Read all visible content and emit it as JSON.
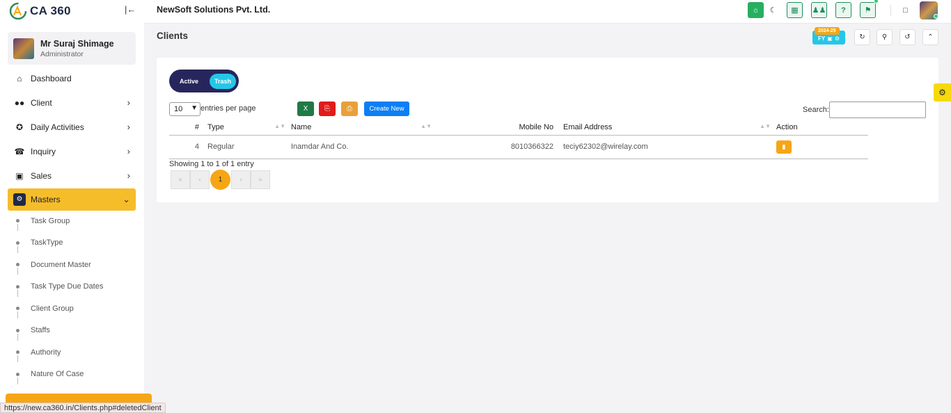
{
  "app": {
    "logo_text": "CA 360",
    "collapse_icon": "collapse-left-icon"
  },
  "user": {
    "name": "Mr Suraj Shimage",
    "role": "Administrator"
  },
  "sidebar": {
    "items": [
      {
        "label": "Dashboard",
        "icon": "home-icon"
      },
      {
        "label": "Client",
        "icon": "users-icon"
      },
      {
        "label": "Daily Activities",
        "icon": "pin-icon"
      },
      {
        "label": "Inquiry",
        "icon": "phone-icon"
      },
      {
        "label": "Sales",
        "icon": "money-icon"
      },
      {
        "label": "Masters",
        "icon": "gears-icon"
      }
    ],
    "sub_items": [
      "Task Group",
      "TaskType",
      "Document Master",
      "Task Type Due Dates",
      "Client Group",
      "Staffs",
      "Authority",
      "Nature Of Case"
    ]
  },
  "header": {
    "company": "NewSoft Solutions Pvt. Ltd."
  },
  "page": {
    "title": "Clients",
    "fy_year": "2024-25",
    "fy_label": "FY"
  },
  "toggle": {
    "active_label": "Active",
    "trash_label": "Trash"
  },
  "table_controls": {
    "page_length": "10",
    "length_label": "entries per page",
    "create_label": "Create New",
    "search_label": "Search:",
    "search_value": ""
  },
  "table": {
    "columns": [
      "#",
      "Type",
      "Name",
      "Mobile No",
      "Email Address",
      "Action"
    ],
    "rows": [
      {
        "idx": "4",
        "type": "Regular",
        "name": "Inamdar And Co.",
        "mobile": "8010366322",
        "email": "teciy62302@wirelay.com"
      }
    ]
  },
  "pagination": {
    "info": "Showing 1 to 1 of 1 entry",
    "first": "«",
    "prev": "‹",
    "current": "1",
    "next": "›",
    "last": "»"
  },
  "statusbar": {
    "url": "https://new.ca360.in/Clients.php#deletedClient"
  },
  "colors": {
    "accent": "#f6bd2b",
    "primary": "#0d7ff3",
    "navy": "#27265c",
    "cyan": "#25c6e8"
  }
}
